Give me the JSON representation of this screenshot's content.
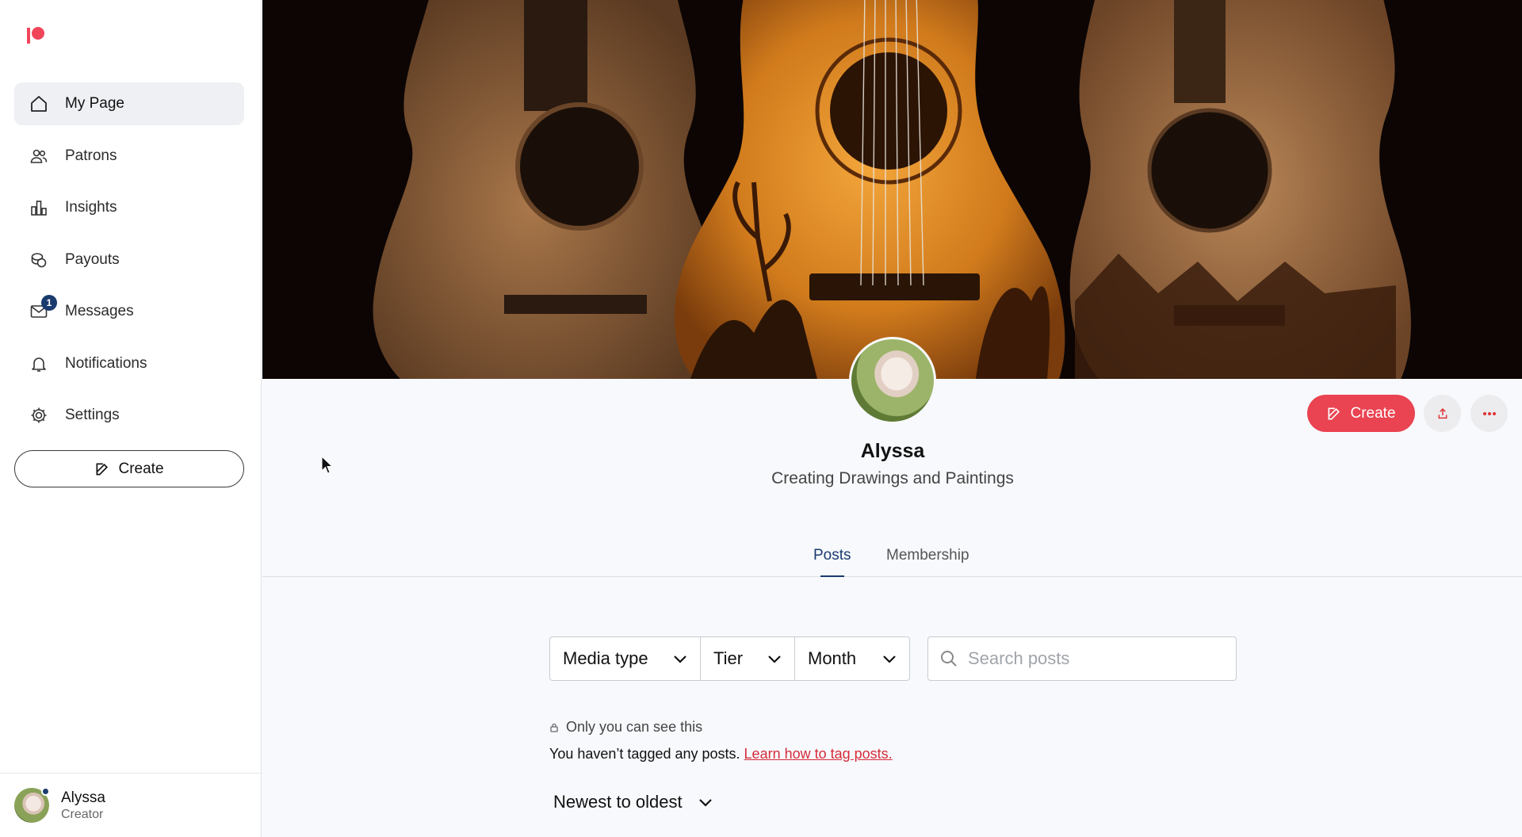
{
  "sidebar": {
    "logo": "patreon-logo",
    "items": [
      {
        "label": "My Page",
        "icon": "home-icon",
        "active": true
      },
      {
        "label": "Patrons",
        "icon": "users-icon"
      },
      {
        "label": "Insights",
        "icon": "bar-chart-icon"
      },
      {
        "label": "Payouts",
        "icon": "coins-icon"
      },
      {
        "label": "Messages",
        "icon": "mail-icon",
        "badge": "1"
      },
      {
        "label": "Notifications",
        "icon": "bell-icon"
      },
      {
        "label": "Settings",
        "icon": "gear-icon"
      }
    ],
    "create_label": "Create",
    "user": {
      "name": "Alyssa",
      "role": "Creator"
    }
  },
  "profile": {
    "name": "Alyssa",
    "tagline": "Creating Drawings and Paintings",
    "create_label": "Create"
  },
  "tabs": [
    {
      "label": "Posts",
      "active": true
    },
    {
      "label": "Membership"
    }
  ],
  "filters": {
    "media_type": "Media type",
    "tier": "Tier",
    "month": "Month",
    "search_placeholder": "Search posts"
  },
  "notice": {
    "privacy": "Only you can see this",
    "message": "You haven’t tagged any posts.",
    "link": "Learn how to tag posts."
  },
  "sort": {
    "label": "Newest to oldest"
  },
  "colors": {
    "brand": "#ea4351",
    "accent_navy": "#1a3b6e",
    "link_red": "#d52b3a"
  }
}
